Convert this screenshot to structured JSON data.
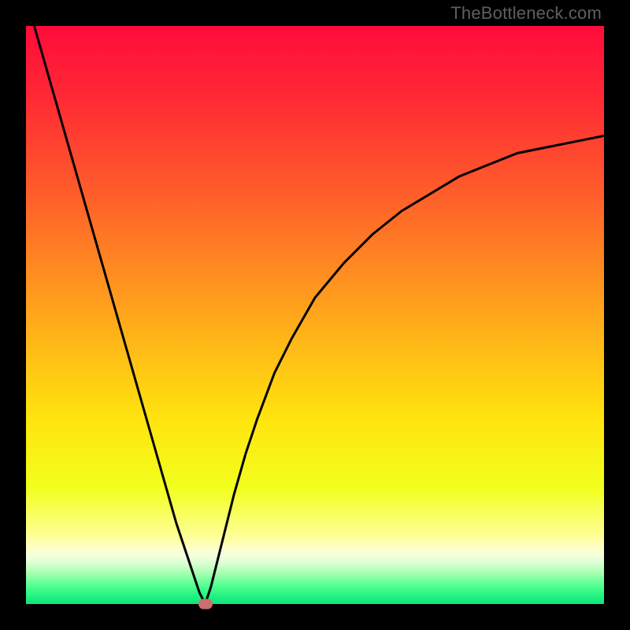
{
  "watermark": {
    "text": "TheBottleneck.com"
  },
  "chart_data": {
    "type": "line",
    "title": "",
    "xlabel": "",
    "ylabel": "",
    "xlim": [
      0,
      100
    ],
    "ylim": [
      0,
      100
    ],
    "series": [
      {
        "name": "curve",
        "x": [
          0,
          2,
          4,
          6,
          8,
          10,
          12,
          14,
          16,
          18,
          20,
          22,
          24,
          26,
          28,
          30,
          31,
          32,
          34,
          36,
          38,
          40,
          43,
          46,
          50,
          55,
          60,
          65,
          70,
          75,
          80,
          85,
          90,
          95,
          100
        ],
        "y": [
          105,
          98,
          91,
          84,
          77,
          70,
          63,
          56,
          49,
          42,
          35,
          28,
          21,
          14,
          8,
          2,
          0,
          3,
          11,
          19,
          26,
          32,
          40,
          46,
          53,
          59,
          64,
          68,
          71,
          74,
          76,
          78,
          79,
          80,
          81
        ]
      }
    ],
    "gradient_stops": [
      {
        "pos": 0.0,
        "color": "#ff0b3a"
      },
      {
        "pos": 0.12,
        "color": "#ff2835"
      },
      {
        "pos": 0.28,
        "color": "#ff5a2b"
      },
      {
        "pos": 0.42,
        "color": "#ff8a21"
      },
      {
        "pos": 0.55,
        "color": "#ffb817"
      },
      {
        "pos": 0.68,
        "color": "#ffe40e"
      },
      {
        "pos": 0.8,
        "color": "#f2ff1e"
      },
      {
        "pos": 0.885,
        "color": "#feff9b"
      },
      {
        "pos": 0.905,
        "color": "#fdffce"
      },
      {
        "pos": 0.918,
        "color": "#f2ffde"
      },
      {
        "pos": 0.93,
        "color": "#d8ffd1"
      },
      {
        "pos": 0.945,
        "color": "#abffb3"
      },
      {
        "pos": 0.958,
        "color": "#7aff9e"
      },
      {
        "pos": 0.97,
        "color": "#4cff8f"
      },
      {
        "pos": 0.985,
        "color": "#25f383"
      },
      {
        "pos": 1.0,
        "color": "#10e37a"
      }
    ],
    "marker": {
      "x": 31,
      "y": 0,
      "color": "#cc6f70"
    }
  }
}
